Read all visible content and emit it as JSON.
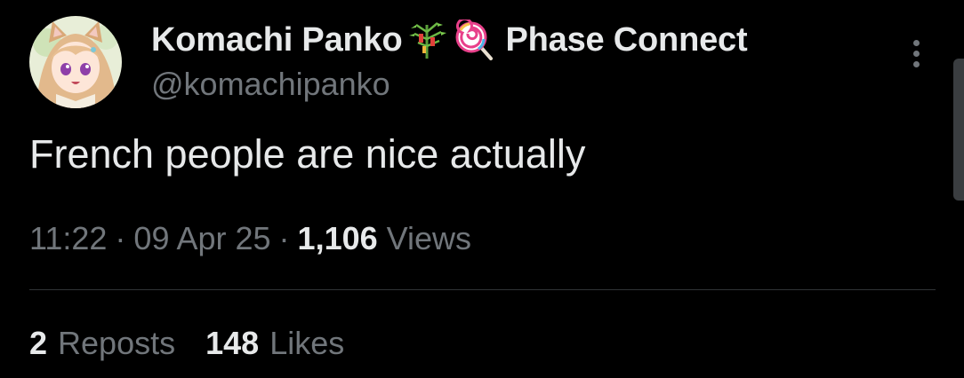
{
  "author": {
    "display_name": "Komachi Panko",
    "emoji_icons": [
      "tanabata-tree-icon",
      "lollipop-icon"
    ],
    "affiliation": "Phase Connect",
    "handle": "@komachipanko"
  },
  "tweet": {
    "text": "French people are nice actually",
    "time": "11:22",
    "separator": "·",
    "date": "09 Apr 25",
    "views_count": "1,106",
    "views_label": "Views"
  },
  "stats": {
    "reposts_count": "2",
    "reposts_label": "Reposts",
    "likes_count": "148",
    "likes_label": "Likes"
  },
  "colors": {
    "background": "#000000",
    "primary_text": "#e7e9ea",
    "secondary_text": "#71767b",
    "divider": "#2f3336"
  }
}
